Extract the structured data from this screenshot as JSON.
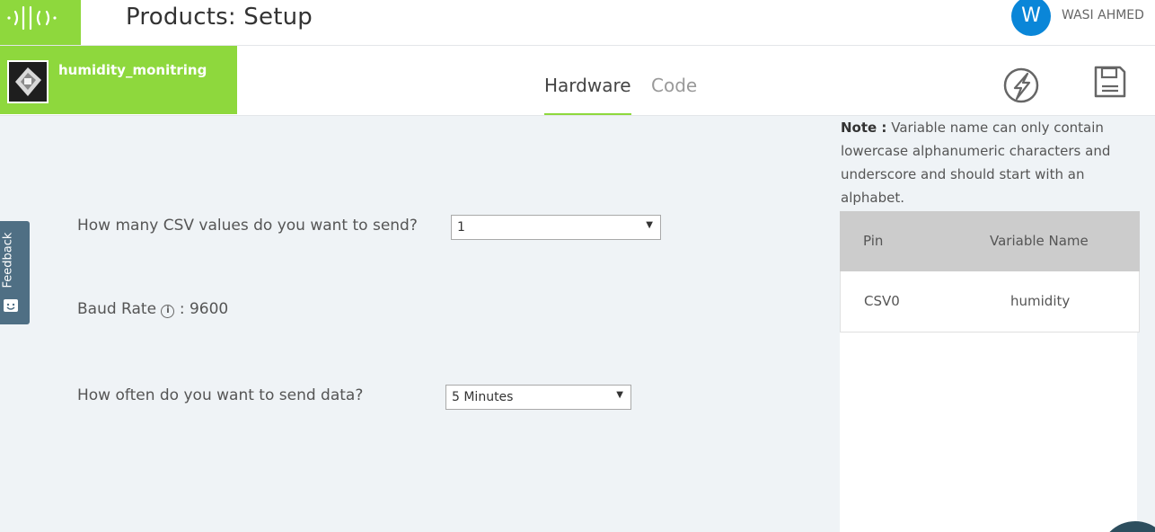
{
  "header": {
    "title": "Products: Setup",
    "user_initial": "W",
    "user_name": "WASI AHMED"
  },
  "product": {
    "name": "humidity_monitring"
  },
  "tabs": [
    {
      "label": "Hardware",
      "active": true
    },
    {
      "label": "Code",
      "active": false
    }
  ],
  "form": {
    "csv_question": "How many CSV values do you want to send?",
    "csv_value": "1",
    "baud_label": "Baud Rate",
    "baud_info_icon": "i",
    "baud_value": ": 9600",
    "frequency_question": "How often do you want to send data?",
    "frequency_value": "5 Minutes"
  },
  "feedback": {
    "label": "Feedback"
  },
  "note": {
    "label": "Note :",
    "text": "Variable name can only contain lowercase alphanumeric characters and underscore and should start with an alphabet."
  },
  "variables_table": {
    "columns": [
      "Pin",
      "Variable Name"
    ],
    "rows": [
      {
        "pin": "CSV0",
        "variable": "humidity"
      }
    ]
  },
  "colors": {
    "accent_green": "#8ed83d",
    "avatar_blue": "#0a86d8",
    "feedback_slate": "#4f6f84",
    "background": "#eff3f6"
  },
  "icons": [
    "logo-waves-icon",
    "deploy-bolt-icon",
    "save-floppy-icon",
    "info-icon",
    "feedback-smile-icon",
    "select-caret-icon"
  ]
}
